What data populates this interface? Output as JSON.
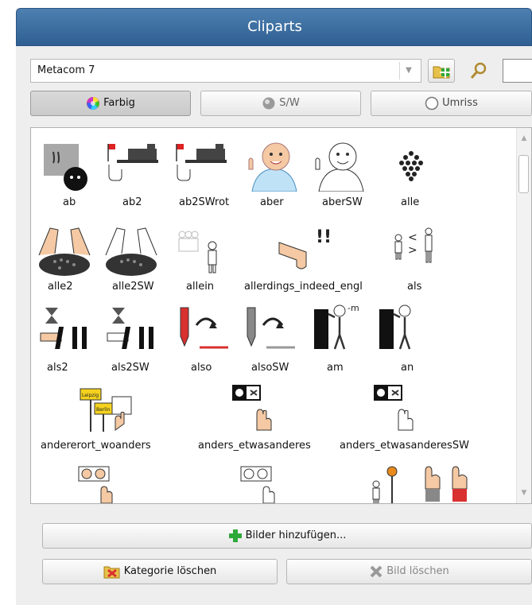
{
  "window": {
    "title": "Cliparts"
  },
  "category": {
    "selected": "Metacom 7"
  },
  "filters": {
    "color": "Farbig",
    "bw": "S/W",
    "outline": "Umriss"
  },
  "items": [
    "ab",
    "ab2",
    "ab2SWrot",
    "aber",
    "aberSW",
    "alle",
    "alle2",
    "alle2SW",
    "allein",
    "allerdings_indeed_engl",
    "als",
    "als2",
    "als2SW",
    "also",
    "alsoSW",
    "am",
    "an",
    "andererort_woanders",
    "anders_etwasanderes",
    "anders_etwasanderesSW"
  ],
  "sign_labels": {
    "sign1": "Leipzig",
    "sign2": "Berlin",
    "am_suffix": "-m"
  },
  "actions": {
    "add_images": "Bilder hinzufügen...",
    "delete_category": "Kategorie löschen",
    "delete_image": "Bild löschen"
  },
  "colors": {
    "titlebar": "#3a6b9d",
    "accent_red": "#d93030",
    "sign_yellow": "#f4d21e",
    "add_green": "#2fa83a"
  }
}
